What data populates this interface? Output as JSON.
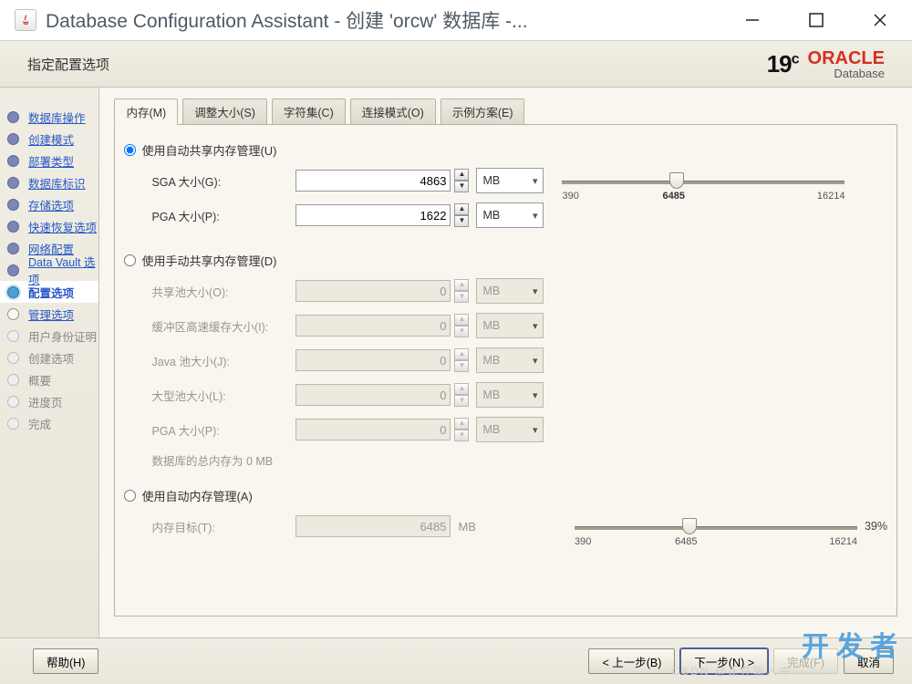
{
  "titlebar": {
    "title": "Database Configuration Assistant - 创建 'orcw' 数据库 -..."
  },
  "header": {
    "title": "指定配置选项"
  },
  "brand": {
    "v": "19",
    "c": "c",
    "oracle": "ORACLE",
    "db": "Database"
  },
  "steps": [
    {
      "label": "数据库操作",
      "cls": "done link"
    },
    {
      "label": "创建模式",
      "cls": "done link"
    },
    {
      "label": "部署类型",
      "cls": "done link"
    },
    {
      "label": "数据库标识",
      "cls": "done link"
    },
    {
      "label": "存储选项",
      "cls": "done link"
    },
    {
      "label": "快速恢复选项",
      "cls": "done link"
    },
    {
      "label": "网络配置",
      "cls": "done link"
    },
    {
      "label": "Data Vault 选项",
      "cls": "done link"
    },
    {
      "label": "配置选项",
      "cls": "current"
    },
    {
      "label": "管理选项",
      "cls": "link"
    },
    {
      "label": "用户身份证明",
      "cls": "future"
    },
    {
      "label": "创建选项",
      "cls": "future"
    },
    {
      "label": "概要",
      "cls": "future"
    },
    {
      "label": "进度页",
      "cls": "future"
    },
    {
      "label": "完成",
      "cls": "future"
    }
  ],
  "tabs": {
    "memory": "内存(M)",
    "sizing": "调整大小(S)",
    "charset": "字符集(C)",
    "conn": "连接模式(O)",
    "sample": "示例方案(E)"
  },
  "mem": {
    "auto_shared": "使用自动共享内存管理(U)",
    "sga_label": "SGA 大小(G):",
    "sga_value": "4863",
    "sga_unit": "MB",
    "pga_label": "PGA 大小(P):",
    "pga_value": "1622",
    "pga_unit": "MB",
    "slider_min": "390",
    "slider_val": "6485",
    "slider_max": "16214",
    "manual_shared": "使用手动共享内存管理(D)",
    "pool_label": "共享池大小(O):",
    "pool_val": "0",
    "pool_unit": "MB",
    "buf_label": "缓冲区高速缓存大小(I):",
    "buf_val": "0",
    "buf_unit": "MB",
    "java_label": "Java 池大小(J):",
    "java_val": "0",
    "java_unit": "MB",
    "large_label": "大型池大小(L):",
    "large_val": "0",
    "large_unit": "MB",
    "mpga_label": "PGA 大小(P):",
    "mpga_val": "0",
    "mpga_unit": "MB",
    "total": "数据库的总内存为 0 MB",
    "auto_mem": "使用自动内存管理(A)",
    "target_label": "内存目标(T):",
    "target_val": "6485",
    "target_unit": "MB",
    "slider2_min": "390",
    "slider2_val": "6485",
    "slider2_max": "16214",
    "percent": "39%"
  },
  "buttons": {
    "help": "帮助(H)",
    "back": "< 上一步(B)",
    "next": "下一步(N) >",
    "finish": "完成(F)",
    "cancel": "取消"
  },
  "watermark": "开 发 者",
  "csdn": "CSDN @正在输入中………"
}
